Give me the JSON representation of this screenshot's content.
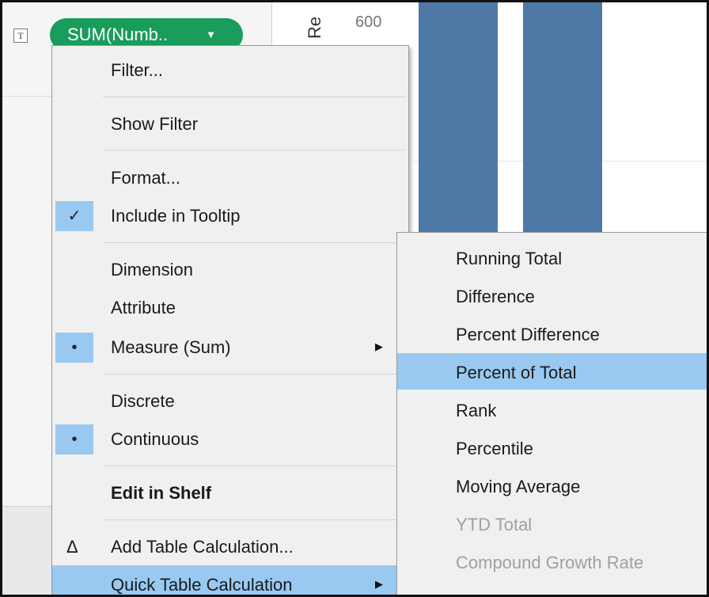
{
  "shelf": {
    "pill_label": "SUM(Numb..",
    "text_mark_glyph": "T"
  },
  "chart": {
    "axis_title": "Re",
    "tick_label": "600",
    "bar_color": "#4e79a7"
  },
  "context_menu": {
    "filter": "Filter...",
    "show_filter": "Show Filter",
    "format": "Format...",
    "include_in_tooltip": "Include in Tooltip",
    "dimension": "Dimension",
    "attribute": "Attribute",
    "measure": "Measure (Sum)",
    "discrete": "Discrete",
    "continuous": "Continuous",
    "edit_in_shelf": "Edit in Shelf",
    "add_table_calculation": "Add Table Calculation...",
    "quick_table_calculation": "Quick Table Calculation",
    "check_glyph": "✓",
    "bullet_glyph": "•",
    "delta_glyph": "Δ",
    "arrow_glyph": "▶"
  },
  "submenu": {
    "running_total": "Running Total",
    "difference": "Difference",
    "percent_difference": "Percent Difference",
    "percent_of_total": "Percent of Total",
    "rank": "Rank",
    "percentile": "Percentile",
    "moving_average": "Moving Average",
    "ytd_total": "YTD Total",
    "compound_growth_rate": "Compound Growth Rate"
  },
  "colors": {
    "pill_green": "#1a9c5c",
    "menu_highlight": "#99c9f0",
    "menu_bg": "#f0f0f0"
  }
}
